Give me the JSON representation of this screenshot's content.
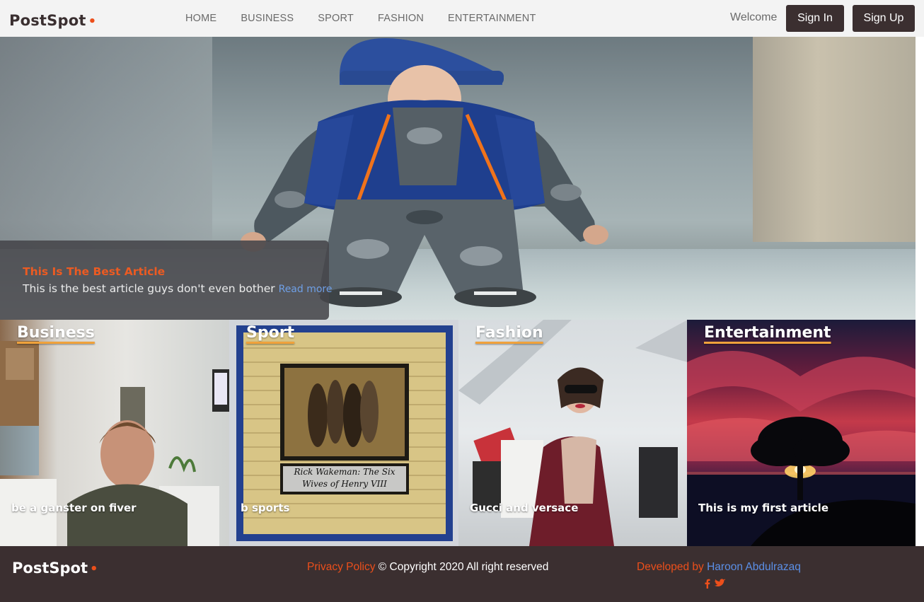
{
  "nav": {
    "logo": "PostSpot",
    "logo_dot": "•",
    "items": [
      {
        "label": "HOME"
      },
      {
        "label": "BUSINESS"
      },
      {
        "label": "SPORT"
      },
      {
        "label": "FASHION"
      },
      {
        "label": "ENTERTAINMENT"
      }
    ],
    "welcome": "Welcome",
    "sign_in": "Sign In",
    "sign_up": "Sign Up"
  },
  "hero": {
    "title": "This Is The Best Article",
    "text": "This is the best article guys don't even bother",
    "read_more": "Read more"
  },
  "categories": [
    {
      "title": "Business",
      "article": "be a ganster on fiver"
    },
    {
      "title": "Sport",
      "article": "b sports"
    },
    {
      "title": "Fashion",
      "article": "Gucci and versace"
    },
    {
      "title": "Entertainment",
      "article": "This is my first article"
    }
  ],
  "sport_cover": {
    "line1": "Rick Wakeman: The Six",
    "line2": "Wives of Henry VIII"
  },
  "footer": {
    "logo": "PostSpot",
    "logo_dot": "•",
    "privacy": "Privacy Policy",
    "copyright": "© Copyright 2020 All right reserved",
    "developed_by": "Developed by",
    "developer": "Haroon Abdulrazaq",
    "social": [
      "facebook-icon",
      "twitter-icon"
    ]
  },
  "colors": {
    "accent": "#ec4f1b",
    "dark": "#3b2f30",
    "link_blue": "#5b8fe6",
    "underline": "#f0a23b"
  }
}
